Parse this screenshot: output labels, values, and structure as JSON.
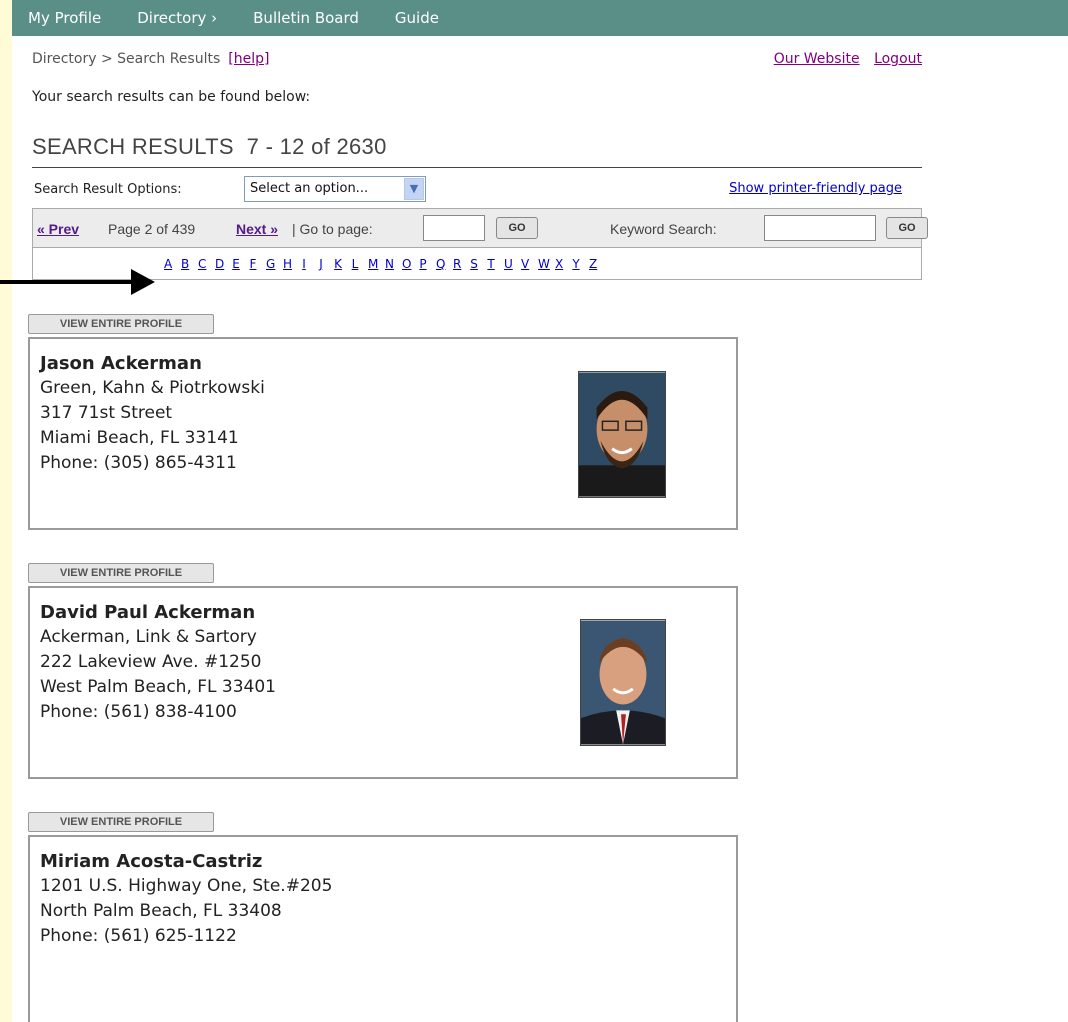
{
  "nav": {
    "items": [
      "My Profile",
      "Directory ›",
      "Bulletin Board",
      "Guide"
    ]
  },
  "breadcrumb": {
    "text": "Directory > Search Results",
    "help": "[help]",
    "our_website": "Our Website",
    "logout": "Logout"
  },
  "intro": "Your search results can be found below:",
  "results_title": "SEARCH RESULTS  7 - 12 of 2630",
  "options": {
    "label": "Search Result Options:",
    "select_value": "Select an option...",
    "printer_link": "Show printer-friendly page"
  },
  "pager": {
    "prev": "« Prev",
    "page_info": "Page 2 of 439",
    "next": "Next »",
    "goto_label": "| Go to page:",
    "go": "GO",
    "keyword_label": "Keyword Search:",
    "keyword_go": "GO"
  },
  "alphabet": [
    "A",
    "B",
    "C",
    "D",
    "E",
    "F",
    "G",
    "H",
    "I",
    "J",
    "K",
    "L",
    "M",
    "N",
    "O",
    "P",
    "Q",
    "R",
    "S",
    "T",
    "U",
    "V",
    "W",
    "X",
    "Y",
    "Z"
  ],
  "view_profile_label": "VIEW ENTIRE PROFILE",
  "results": [
    {
      "name": "Jason Ackerman",
      "lines": [
        "Green, Kahn & Piotrkowski",
        "317 71st Street",
        "Miami Beach, FL 33141",
        "Phone: (305) 865-4311"
      ],
      "has_photo": true
    },
    {
      "name": "David Paul Ackerman",
      "lines": [
        "Ackerman, Link & Sartory",
        "222 Lakeview Ave. #1250",
        "West Palm Beach, FL 33401",
        "Phone: (561) 838-4100"
      ],
      "has_photo": true
    },
    {
      "name": "Miriam Acosta-Castriz",
      "lines": [
        "1201 U.S. Highway One, Ste.#205",
        "North Palm Beach, FL 33408",
        "Phone: (561) 625-1122"
      ],
      "has_photo": false
    }
  ]
}
